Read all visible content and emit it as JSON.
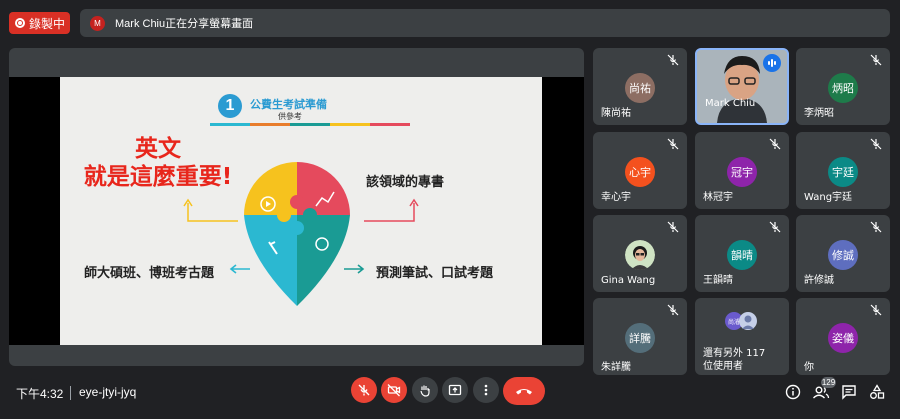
{
  "recording": {
    "label": "錄製中"
  },
  "share_banner": {
    "avatar_letter": "M",
    "text": "Mark Chiu正在分享螢幕畫面"
  },
  "slide": {
    "number": "1",
    "title": "公費生考試準備",
    "subtitle": "供參考",
    "headline_line1": "英文",
    "headline_line2": "就是這麼重要!",
    "text_right_top": "該領域的專書",
    "text_left_bottom": "師大碩班、博班考古題",
    "text_right_bottom": "預測筆試、口試考題",
    "colors": [
      "#f6c21e",
      "#e54a5d",
      "#1a9b94",
      "#2bb8d1",
      "#e87d2c"
    ]
  },
  "participants": [
    {
      "avatar": "尚祐",
      "name": "陳尚祐",
      "color": "#8d6e63",
      "video": false
    },
    {
      "avatar": "",
      "name": "Mark Chiu",
      "color": "",
      "video": true
    },
    {
      "avatar": "炳昭",
      "name": "李炳昭",
      "color": "#1e7b4a",
      "video": false
    },
    {
      "avatar": "心宇",
      "name": "幸心宇",
      "color": "#f4511e",
      "video": false
    },
    {
      "avatar": "冠宇",
      "name": "林冠宇",
      "color": "#8e24aa",
      "video": false
    },
    {
      "avatar": "宇廷",
      "name": "Wang宇廷",
      "color": "#0b8a86",
      "video": false
    },
    {
      "avatar": "",
      "name": "Gina Wang",
      "color": "#5f6368",
      "video": false
    },
    {
      "avatar": "韻晴",
      "name": "王韻晴",
      "color": "#0b8a86",
      "video": false
    },
    {
      "avatar": "修誠",
      "name": "許修誠",
      "color": "#5e6ebf",
      "video": false
    },
    {
      "avatar": "詳騰",
      "name": "朱詳騰",
      "color": "#546e7a",
      "video": false
    },
    {
      "avatar": "尚濬",
      "name": "還有另外 117 位使用者",
      "color": "#6a5acd",
      "video": false
    },
    {
      "avatar": "姿儀",
      "name": "你",
      "color": "#8e24aa",
      "video": false
    }
  ],
  "bottom": {
    "time": "下午4:32",
    "meeting_code": "eye-jtyi-jyq",
    "people_count": "129"
  },
  "icons": {
    "mic_off": "mic-off-icon",
    "camera_off": "camera-off-icon",
    "raise_hand": "hand-icon",
    "present": "present-icon",
    "more": "more-vert-icon",
    "end_call": "call-end-icon",
    "info": "info-icon",
    "people": "people-icon",
    "chat": "chat-icon",
    "activities": "activities-icon"
  }
}
